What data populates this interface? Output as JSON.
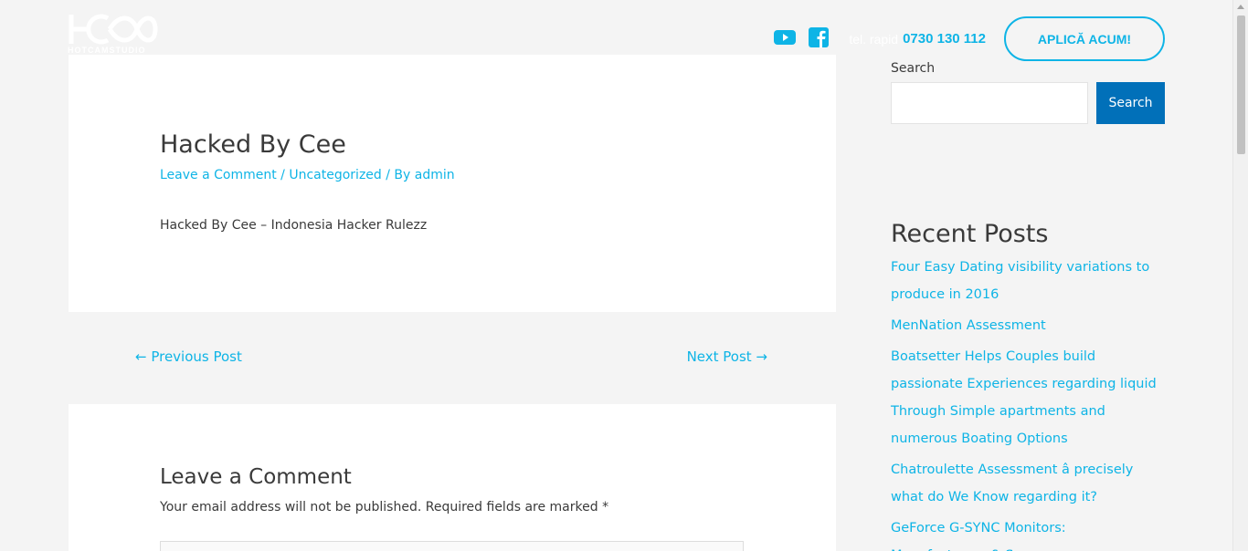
{
  "header": {
    "logo_sub": "HOTCAMSTUDIO",
    "tel_label": "tel. rapid",
    "tel_number": "0730 130 112",
    "apply_label": "APLICĂ ACUM!",
    "icons": [
      "youtube-icon",
      "facebook-icon"
    ]
  },
  "article": {
    "title": "Hacked By Cee",
    "meta_comment": "Leave a Comment",
    "meta_category": "Uncategorized",
    "meta_by": "By",
    "meta_author": "admin",
    "body": "Hacked By Cee – Indonesia Hacker Rulezz"
  },
  "post_nav": {
    "prev": "← Previous Post",
    "next": "Next Post →"
  },
  "comment": {
    "title": "Leave a Comment",
    "notes": "Your email address will not be published. Required fields are marked *"
  },
  "sidebar": {
    "search_label": "Search",
    "search_button": "Search",
    "search_value": "",
    "recent_title": "Recent Posts",
    "recent_posts": [
      "Four Easy Dating visibility variations to produce in 2016",
      "MenNation Assessment",
      "Boatsetter Helps Couples build passionate Experiences regarding liquid Through Simple apartments and numerous Boating Options",
      "Chatroulette Assessment â precisely what do We Know regarding it?",
      "GeForce G-SYNC Monitors: Manufacturers & Specs"
    ]
  },
  "colors": {
    "accent": "#0eb4e6",
    "search_button": "#0170b9",
    "background": "#f4f4f4",
    "text": "#3a3a3a"
  }
}
